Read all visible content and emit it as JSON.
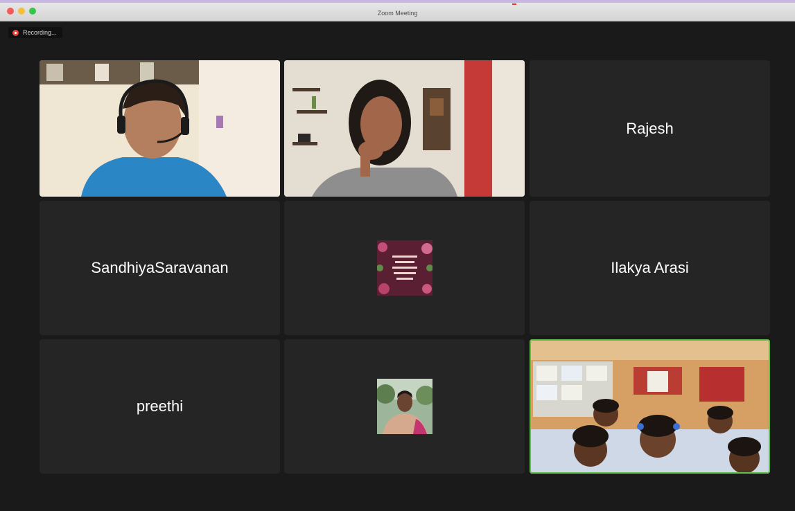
{
  "window": {
    "title": "Zoom Meeting",
    "recording_label": "Recording..."
  },
  "colors": {
    "tile_bg": "#252525",
    "active_speaker_border": "#5ec24a",
    "recording_dot": "#e7453d"
  },
  "participants": [
    {
      "type": "video",
      "subject": "man-with-headset-icon"
    },
    {
      "type": "video",
      "subject": "woman-thinking-icon"
    },
    {
      "type": "name",
      "name": "Rajesh"
    },
    {
      "type": "name",
      "name": "SandhiyaSaravanan"
    },
    {
      "type": "avatar",
      "subject": "book-cover-avatar-icon"
    },
    {
      "type": "name",
      "name": "Ilakya Arasi"
    },
    {
      "type": "name",
      "name": "preethi"
    },
    {
      "type": "avatar",
      "subject": "person-photo-avatar-icon"
    },
    {
      "type": "video",
      "subject": "classroom-children-icon",
      "active_speaker": true
    }
  ]
}
